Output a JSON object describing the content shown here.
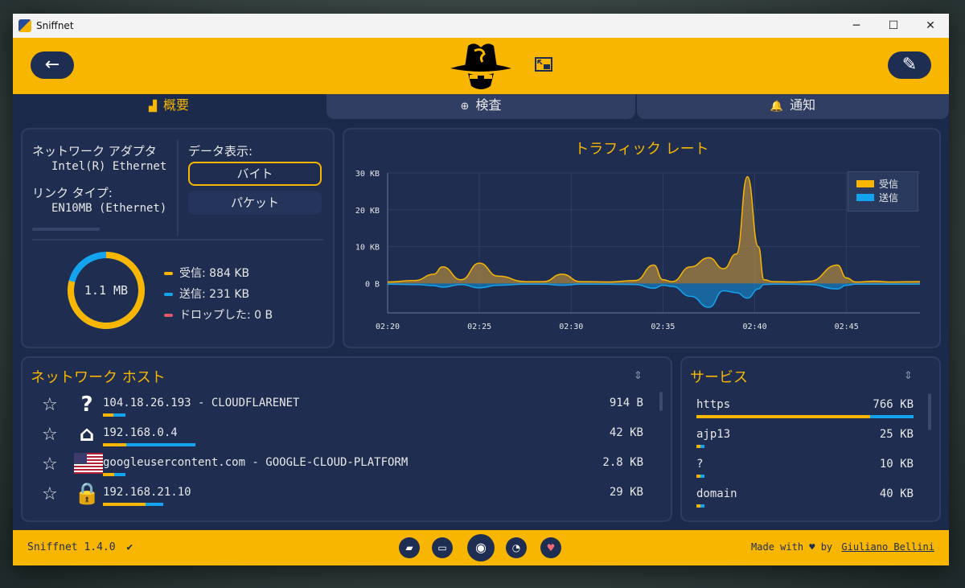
{
  "window": {
    "title": "Sniffnet",
    "minimize": "─",
    "maximize": "☐",
    "close": "✕"
  },
  "header": {
    "back_icon": "←",
    "settings_icon": "✎"
  },
  "tabs": [
    {
      "label": "概要",
      "icon": "chart-icon"
    },
    {
      "label": "検査",
      "icon": "search-icon"
    },
    {
      "label": "通知",
      "icon": "bell-icon"
    }
  ],
  "adapter": {
    "adapter_label": "ネットワーク アダプタ",
    "adapter_value": "Intel(R) Ethernet",
    "link_label": "リンク タイプ:",
    "link_value": "EN10MB (Ethernet)",
    "display_label": "データ表示:",
    "bytes_button": "バイト",
    "packets_button": "パケット"
  },
  "totals": {
    "center": "1.1 MB",
    "received": "受信: 884 KB",
    "sent": "送信: 231 KB",
    "dropped": "ドロップした: 0 B",
    "received_fraction": 0.79,
    "colors": {
      "received": "#f8b600",
      "sent": "#14a3ee",
      "dropped": "#e05a6a"
    }
  },
  "chart_data": {
    "type": "area",
    "title": "トラフィック レート",
    "x_ticks": [
      "02:20",
      "02:25",
      "02:30",
      "02:35",
      "02:40",
      "02:45"
    ],
    "y_ticks": [
      "30 KB",
      "20 KB",
      "10 KB",
      "0 B"
    ],
    "ylim": [
      -8,
      30
    ],
    "legend": [
      "受信",
      "送信"
    ],
    "legend_position": "top-right",
    "x_minutes": [
      0,
      1.5,
      2.5,
      3.0,
      4.0,
      5.0,
      6.0,
      7.5,
      8.5,
      9.5,
      10.5,
      12.0,
      13.5,
      14.5,
      15.0,
      15.5,
      16.5,
      17.5,
      18.3,
      19.0,
      19.6,
      20.2,
      20.5,
      21.0,
      22.0,
      23.0,
      24.5,
      25.0,
      25.5,
      26.5,
      27.5,
      29.0
    ],
    "series": [
      {
        "name": "受信",
        "color": "#f8b600",
        "values": [
          0.4,
          0.8,
          2.5,
          4.5,
          1.0,
          5.5,
          2.0,
          0.5,
          0.5,
          2.5,
          0.5,
          0.4,
          0.8,
          5.0,
          1.0,
          0.5,
          4.5,
          7.0,
          4.0,
          8.0,
          29.0,
          10.0,
          1.0,
          0.5,
          0.4,
          0.6,
          5.0,
          1.5,
          0.4,
          0.6,
          0.4,
          0.5
        ]
      },
      {
        "name": "送信",
        "color": "#14a3ee",
        "values": [
          -0.2,
          -0.3,
          -0.6,
          -1.0,
          -0.3,
          -1.2,
          -0.5,
          -0.2,
          -0.2,
          -0.5,
          -0.2,
          -0.2,
          -0.3,
          -1.3,
          -0.5,
          -0.8,
          -3.5,
          -6.5,
          -2.0,
          -2.5,
          -4.0,
          -1.5,
          -0.3,
          -0.2,
          -0.2,
          -0.3,
          -1.5,
          -0.5,
          -0.2,
          -0.2,
          -0.2,
          -0.2
        ]
      }
    ]
  },
  "hosts": {
    "title": "ネットワーク ホスト",
    "sort_icon": "⇕",
    "rows": [
      {
        "name": "104.18.26.193 - CLOUDFLARENET",
        "value": "914 B",
        "icon": "question-icon",
        "glyph": "?",
        "recv": 0.45,
        "sent": 0.55,
        "barw": 28
      },
      {
        "name": "192.168.0.4",
        "value": "42 KB",
        "icon": "home-icon",
        "glyph": "⌂",
        "recv": 0.25,
        "sent": 0.75,
        "barw": 115
      },
      {
        "name": "googleusercontent.com - GOOGLE-CLOUD-PLATFORM",
        "value": "2.8 KB",
        "icon": "us-flag-icon",
        "glyph": "",
        "recv": 0.5,
        "sent": 0.5,
        "barw": 28
      },
      {
        "name": "192.168.21.10",
        "value": "29 KB",
        "icon": "lock-icon",
        "glyph": "🔒",
        "recv": 0.7,
        "sent": 0.3,
        "barw": 75
      }
    ]
  },
  "services": {
    "title": "サービス",
    "sort_icon": "⇕",
    "rows": [
      {
        "name": "https",
        "value": "766 KB",
        "recv": 0.8,
        "sent": 0.2,
        "barw": 270
      },
      {
        "name": "ajp13",
        "value": "25 KB",
        "recv": 0.5,
        "sent": 0.5,
        "barw": 10
      },
      {
        "name": "?",
        "value": "10 KB",
        "recv": 0.5,
        "sent": 0.5,
        "barw": 10
      },
      {
        "name": "domain",
        "value": "40 KB",
        "recv": 0.5,
        "sent": 0.5,
        "barw": 10
      }
    ]
  },
  "footer": {
    "version": "Sniffnet 1.4.0",
    "version_check": "✔",
    "made_with": "Made with ♥ by",
    "author": "Giuliano Bellini",
    "icons": [
      "paint-roller-icon",
      "book-icon",
      "github-icon",
      "rss-icon",
      "heart-icon"
    ]
  }
}
